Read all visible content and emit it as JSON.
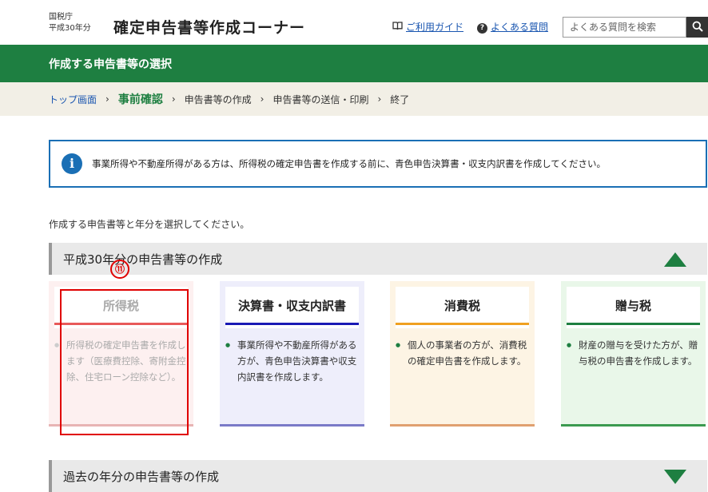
{
  "header": {
    "agency_line1": "国税庁",
    "agency_line2": "平成30年分",
    "title": "確定申告書等作成コーナー",
    "guide_link": "ご利用ガイド",
    "guide_icon": "book-icon",
    "faq_link": "よくある質問",
    "faq_icon": "question-circle-icon",
    "search_placeholder": "よくある質問を検索",
    "search_icon": "search-icon"
  },
  "band": {
    "title": "作成する申告書等の選択"
  },
  "breadcrumb": {
    "items": [
      "トップ画面",
      "事前確認",
      "申告書等の作成",
      "申告書等の送信・印刷",
      "終了"
    ],
    "separator": "›"
  },
  "info": {
    "icon": "info-icon",
    "text": "事業所得や不動産所得がある方は、所得税の確定申告書を作成する前に、青色申告決算書・収支内訳書を作成してください。"
  },
  "instruction": "作成する申告書等と年分を選択してください。",
  "section_current": {
    "title": "平成30年分の申告書等の作成",
    "toggle": "collapse-triangle-icon"
  },
  "section_past": {
    "title": "過去の年分の申告書等の作成",
    "toggle": "expand-triangle-icon"
  },
  "annotation": {
    "label": "⑪"
  },
  "cards": [
    {
      "title": "所得税",
      "desc": "所得税の確定申告書を作成します（医療費控除、寄附金控除、住宅ローン控除など）。",
      "accent": "#e85a5a",
      "bg": "#fdf0f0",
      "foot": "#e8b4b4"
    },
    {
      "title": "決算書・収支内訳書",
      "desc": "事業所得や不動産所得がある方が、青色申告決算書や収支内訳書を作成します。",
      "accent": "#1a1ab5",
      "bg": "#eeeefb",
      "foot": "#7a7ac8"
    },
    {
      "title": "消費税",
      "desc": "個人の事業者の方が、消費税の確定申告書を作成します。",
      "accent": "#f0a020",
      "bg": "#fdf4e4",
      "foot": "#e0a070"
    },
    {
      "title": "贈与税",
      "desc": "財産の贈与を受けた方が、贈与税の申告書を作成します。",
      "accent": "#1e7f41",
      "bg": "#e9f7e9",
      "foot": "#3c9a50"
    }
  ]
}
